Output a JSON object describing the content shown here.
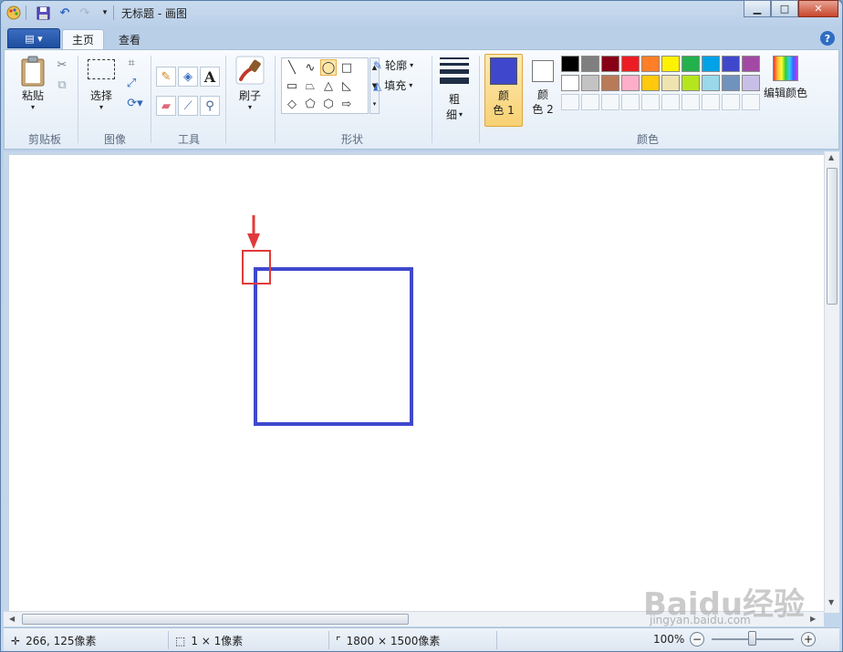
{
  "window": {
    "title": "无标题 - 画图",
    "min_label": "▁",
    "max_label": "□",
    "close_label": "✕"
  },
  "quick_access": {
    "icons": [
      "paint-app-icon",
      "save-icon",
      "undo-icon",
      "redo-icon",
      "customize-dropdown-icon"
    ]
  },
  "tabs": {
    "menu_label": "▤ ▾",
    "home": "主页",
    "view": "查看",
    "help": "?"
  },
  "ribbon": {
    "clipboard": {
      "paste": "粘贴",
      "group": "剪贴板"
    },
    "image": {
      "select": "选择",
      "group": "图像"
    },
    "tools": {
      "group": "工具",
      "text_tool": "A"
    },
    "brush": {
      "label": "刷子"
    },
    "shapes": {
      "outline": "轮廓",
      "fill": "填充",
      "group": "形状"
    },
    "size": {
      "label_top": "粗",
      "label_bottom": "细"
    },
    "colors": {
      "color1_top": "颜",
      "color1_bottom": "色 1",
      "color2_top": "颜",
      "color2_bottom": "色 2",
      "edit": "编辑颜色",
      "group": "颜色",
      "color1_value": "#3f48cc",
      "color2_value": "#ffffff",
      "palette_row1": [
        "#000000",
        "#7f7f7f",
        "#880015",
        "#ed1c24",
        "#ff7f27",
        "#fff200",
        "#22b14c",
        "#00a2e8",
        "#3f48cc",
        "#a349a4"
      ],
      "palette_row2": [
        "#ffffff",
        "#c3c3c3",
        "#b97a57",
        "#ffaec9",
        "#ffc90e",
        "#efe4b0",
        "#b5e61d",
        "#99d9ea",
        "#7092be",
        "#c8bfe7"
      ]
    }
  },
  "canvas": {
    "rect_color": "#3f48cc",
    "marker_color": "#e03b3b"
  },
  "status": {
    "cursor": "266, 125像素",
    "selection": "1 × 1像素",
    "image_size": "1800 × 1500像素",
    "zoom": "100%",
    "zoom_out": "−",
    "zoom_in": "+"
  },
  "watermark": {
    "main": "Baidu经验",
    "sub": "jingyan.baidu.com"
  }
}
